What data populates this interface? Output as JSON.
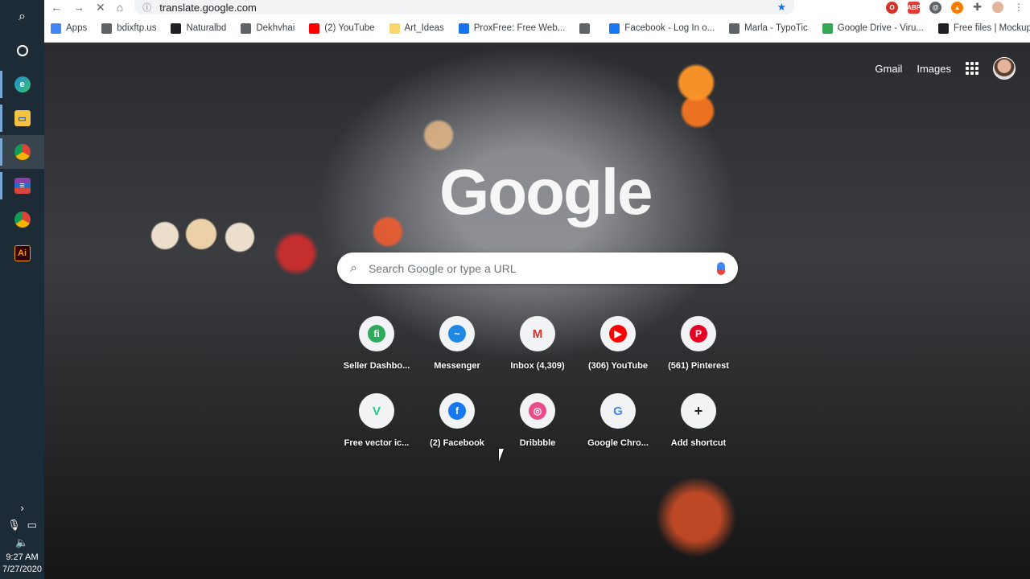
{
  "taskbar": {
    "time": "9:27 AM",
    "date": "7/27/2020"
  },
  "browser": {
    "url": "translate.google.com",
    "bookmarks": [
      {
        "label": "Apps",
        "icon": "apps-grid-icon",
        "color": "#4285f4"
      },
      {
        "label": "bdixftp.us",
        "icon": "globe-icon",
        "color": "#5f6368"
      },
      {
        "label": "Naturalbd",
        "icon": "notion-icon",
        "color": "#202124"
      },
      {
        "label": "Dekhvhai",
        "icon": "globe-icon",
        "color": "#5f6368"
      },
      {
        "label": "(2) YouTube",
        "icon": "youtube-icon",
        "color": "#ff0000"
      },
      {
        "label": "Art_Ideas",
        "icon": "folder-icon",
        "color": "#f9d56e"
      },
      {
        "label": "ProxFree: Free Web...",
        "icon": "proxfree-icon",
        "color": "#1a73e8"
      },
      {
        "label": "",
        "icon": "globe-icon",
        "color": "#5f6368"
      },
      {
        "label": "Facebook - Log In o...",
        "icon": "facebook-icon",
        "color": "#1877f2"
      },
      {
        "label": "Marla - TypoTic",
        "icon": "typotic-icon",
        "color": "#5f6368"
      },
      {
        "label": "Google Drive - Viru...",
        "icon": "drive-icon",
        "color": "#34a853"
      },
      {
        "label": "Free files | Mockup...",
        "icon": "mockup-icon",
        "color": "#202124"
      }
    ]
  },
  "ntp": {
    "gmail": "Gmail",
    "images": "Images",
    "logo": "Google",
    "search_placeholder": "Search Google or type a URL",
    "shortcuts": [
      {
        "label": "Seller Dashbo...",
        "icon": "seller-icon",
        "glyph": "fi",
        "color": "#2eaa5c"
      },
      {
        "label": "Messenger",
        "icon": "messenger-icon",
        "glyph": "~",
        "color": "#1e88e5"
      },
      {
        "label": "Inbox (4,309)",
        "icon": "gmail-icon",
        "glyph": "M",
        "color": "#d93025"
      },
      {
        "label": "(306) YouTube",
        "icon": "youtube-icon",
        "glyph": "▶",
        "color": "#ff0000"
      },
      {
        "label": "(561) Pinterest",
        "icon": "pinterest-icon",
        "glyph": "P",
        "color": "#e60023"
      },
      {
        "label": "Free vector ic...",
        "icon": "freepik-icon",
        "glyph": "V",
        "color": "#1dce8a"
      },
      {
        "label": "(2) Facebook",
        "icon": "facebook-icon",
        "glyph": "f",
        "color": "#1877f2"
      },
      {
        "label": "Dribbble",
        "icon": "dribbble-icon",
        "glyph": "◎",
        "color": "#ea4c89"
      },
      {
        "label": "Google Chro...",
        "icon": "google-icon",
        "glyph": "G",
        "color": "#4285f4"
      },
      {
        "label": "Add shortcut",
        "icon": "plus-icon",
        "glyph": "+",
        "color": "#202124"
      }
    ]
  }
}
